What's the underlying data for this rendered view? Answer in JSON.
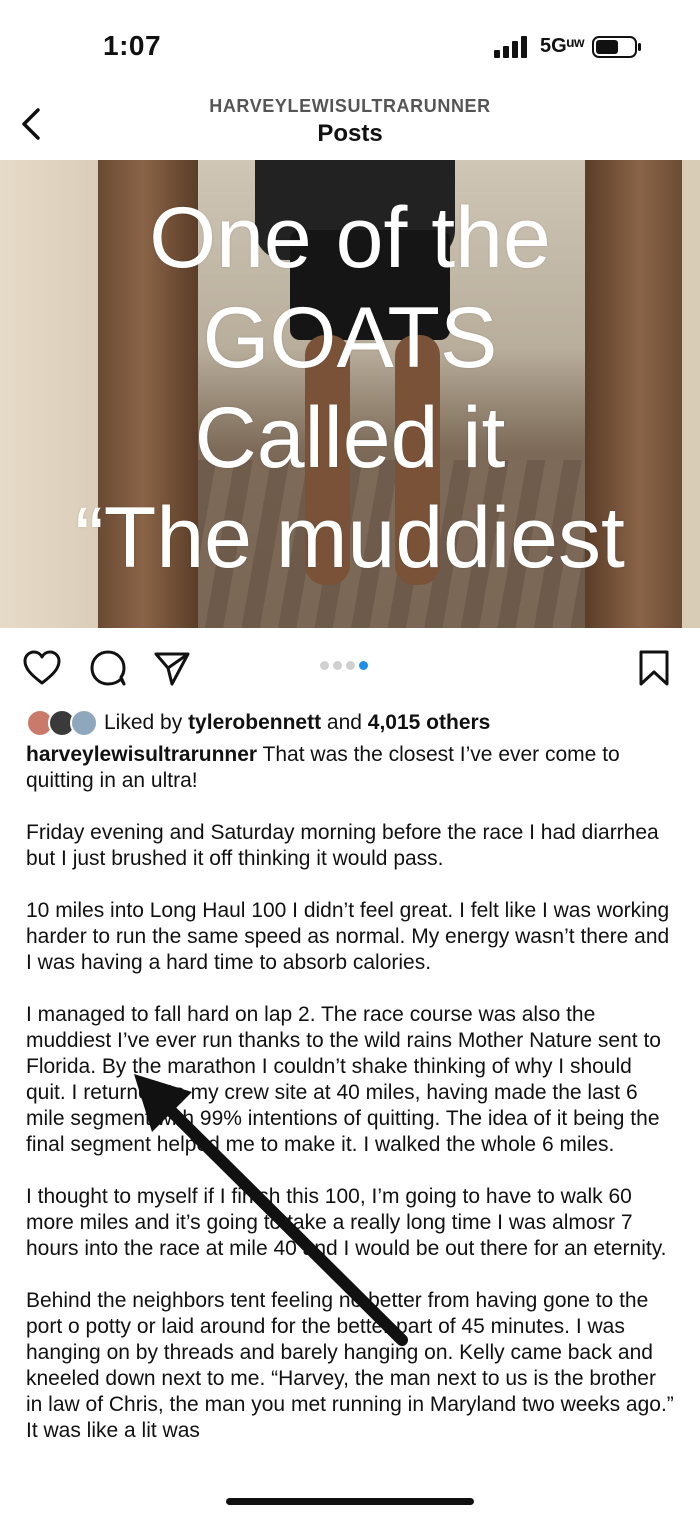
{
  "status_bar": {
    "time": "1:07",
    "network": "5Gᵘʷ",
    "icons": [
      "signal-icon",
      "battery-icon"
    ]
  },
  "header": {
    "account": "HARVEYLEWISULTRARUNNER",
    "title": "Posts",
    "back_icon": "chevron-left-icon"
  },
  "post": {
    "image_text_lines": [
      "One of the",
      "GOATS",
      "Called it",
      "“The muddiest"
    ],
    "carousel": {
      "count": 4,
      "active": 4
    },
    "action_icons": [
      "heart-icon",
      "comment-icon",
      "share-icon",
      "bookmark-icon"
    ],
    "likes": {
      "prefix": "Liked by ",
      "user": "tylerobennett",
      "middle": " and ",
      "others": "4,015 others"
    },
    "caption": {
      "username": "harveylewisultrarunner",
      "first": " That was the closest I’ve ever come to quitting in an ultra!",
      "paragraphs": [
        "Friday evening and Saturday morning before the race I had diarrhea but I just brushed it off thinking it would pass.",
        "10 miles into Long Haul 100 I didn’t feel great. I felt like I was working harder to run the same speed as normal. My energy wasn’t there and I was having a hard time to absorb calories.",
        "I managed to fall hard on lap 2. The race course was also the muddiest I’ve ever run thanks to the wild rains Mother Nature sent to Florida. By the marathon I couldn’t shake thinking of why I should quit. I returned to my crew site at 40 miles, having made the last 6 mile segment with 99% intentions of quitting. The idea of it being the final segment helped me to make it. I walked the whole 6 miles.",
        "I thought to myself if I finish this 100, I’m going to have to walk 60 more miles and it’s going to take a really long time  I was almosr 7 hours into the race at mile 40 and I would be out there for an eternity.",
        "Behind the neighbors tent feeling no better from having gone to the port o potty or laid around for the better part of 45 minutes. I was hanging on by threads and barely hanging on. Kelly came back and kneeled down next to me. “Harvey, the man next to us is the brother in law  of Chris, the man you met running in Maryland two weeks ago.” It was like a lit was"
      ]
    }
  },
  "colors": {
    "accent": "#1d8fe8",
    "text": "#111111",
    "muted": "#555555"
  }
}
